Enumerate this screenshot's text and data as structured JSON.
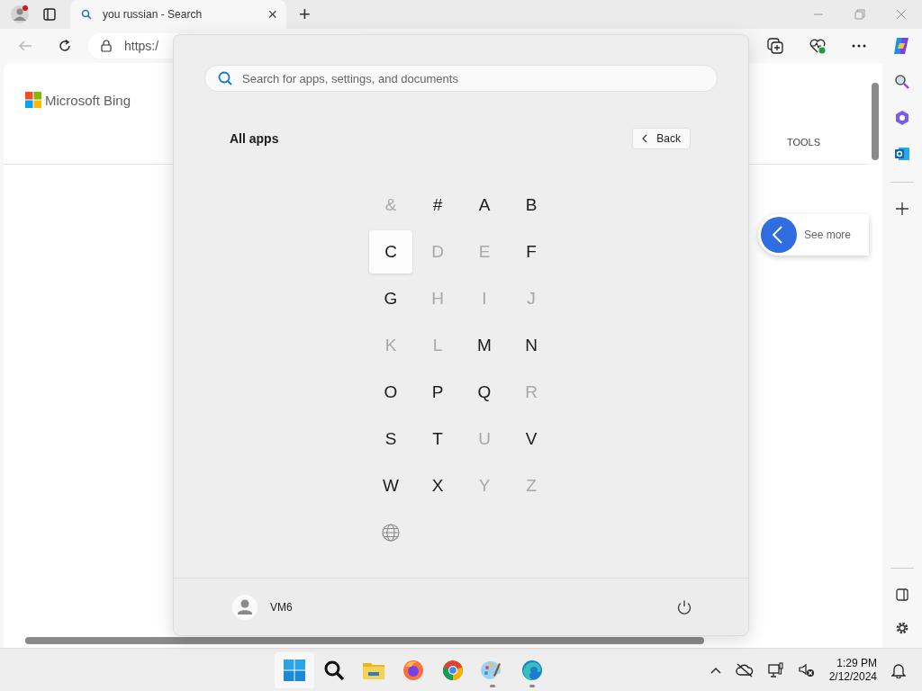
{
  "browser": {
    "tab": {
      "title": "you russian - Search",
      "close": "×"
    },
    "new_tab": "+",
    "address": "https:/",
    "page": {
      "logo_text": "Microsoft Bing",
      "tools": "TOOLS",
      "see_more": "See more"
    }
  },
  "start_menu": {
    "search_placeholder": "Search for apps, settings, and documents",
    "heading": "All apps",
    "back": "Back",
    "letters": [
      {
        "label": "&",
        "disabled": true,
        "hovered": false
      },
      {
        "label": "#",
        "disabled": false,
        "hovered": false
      },
      {
        "label": "A",
        "disabled": false,
        "hovered": false
      },
      {
        "label": "B",
        "disabled": false,
        "hovered": false
      },
      {
        "label": "C",
        "disabled": false,
        "hovered": true
      },
      {
        "label": "D",
        "disabled": true,
        "hovered": false
      },
      {
        "label": "E",
        "disabled": true,
        "hovered": false
      },
      {
        "label": "F",
        "disabled": false,
        "hovered": false
      },
      {
        "label": "G",
        "disabled": false,
        "hovered": false
      },
      {
        "label": "H",
        "disabled": true,
        "hovered": false
      },
      {
        "label": "I",
        "disabled": true,
        "hovered": false
      },
      {
        "label": "J",
        "disabled": true,
        "hovered": false
      },
      {
        "label": "K",
        "disabled": true,
        "hovered": false
      },
      {
        "label": "L",
        "disabled": true,
        "hovered": false
      },
      {
        "label": "M",
        "disabled": false,
        "hovered": false
      },
      {
        "label": "N",
        "disabled": false,
        "hovered": false
      },
      {
        "label": "O",
        "disabled": false,
        "hovered": false
      },
      {
        "label": "P",
        "disabled": false,
        "hovered": false
      },
      {
        "label": "Q",
        "disabled": false,
        "hovered": false
      },
      {
        "label": "R",
        "disabled": true,
        "hovered": false
      },
      {
        "label": "S",
        "disabled": false,
        "hovered": false
      },
      {
        "label": "T",
        "disabled": false,
        "hovered": false
      },
      {
        "label": "U",
        "disabled": true,
        "hovered": false
      },
      {
        "label": "V",
        "disabled": false,
        "hovered": false
      },
      {
        "label": "W",
        "disabled": false,
        "hovered": false
      },
      {
        "label": "X",
        "disabled": false,
        "hovered": false
      },
      {
        "label": "Y",
        "disabled": true,
        "hovered": false
      },
      {
        "label": "Z",
        "disabled": true,
        "hovered": false
      }
    ],
    "user": "VM6"
  },
  "taskbar": {
    "apps": [
      {
        "kind": "start",
        "running": false
      },
      {
        "kind": "search",
        "running": false
      },
      {
        "kind": "folder",
        "running": false
      },
      {
        "kind": "firefox",
        "running": false
      },
      {
        "kind": "chrome",
        "running": false
      },
      {
        "kind": "paint",
        "running": true
      },
      {
        "kind": "edge",
        "running": true
      }
    ],
    "time": "1:29 PM",
    "date": "2/12/2024"
  }
}
